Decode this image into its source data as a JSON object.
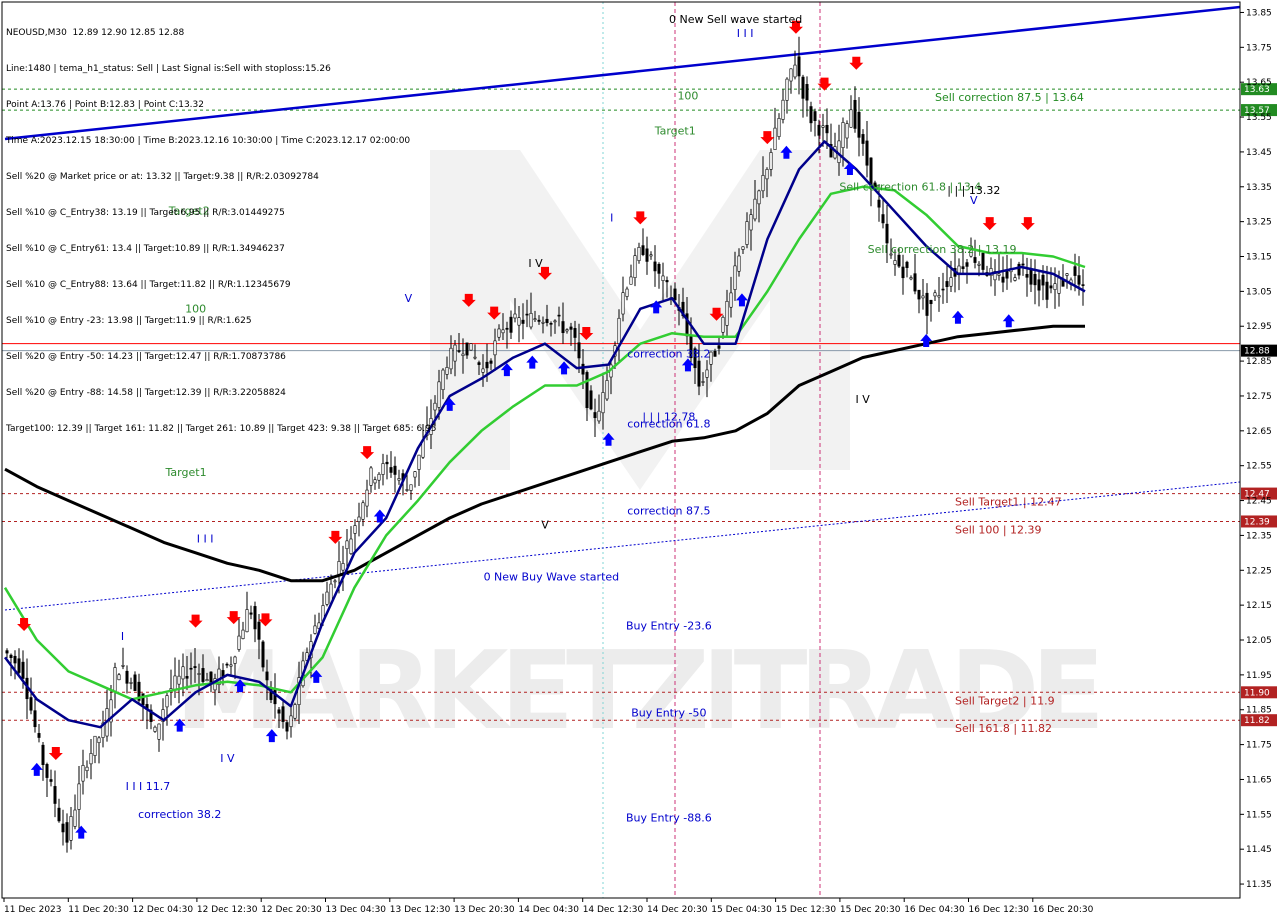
{
  "symbol_line": "NEOUSD,M30  12.89 12.90 12.85 12.88",
  "info_lines": [
    "Line:1480 | tema_h1_status: Sell | Last Signal is:Sell with stoploss:15.26",
    "Point A:13.76 | Point B:12.83 | Point C:13.32",
    "Time A:2023.12.15 18:30:00 | Time B:2023.12.16 10:30:00 | Time C:2023.12.17 02:00:00",
    "Sell %20 @ Market price or at: 13.32 || Target:9.38 || R/R:2.03092784",
    "Sell %10 @ C_Entry38: 13.19 || Target:6.95 || R/R:3.01449275",
    "Sell %10 @ C_Entry61: 13.4 || Target:10.89 || R/R:1.34946237",
    "Sell %10 @ C_Entry88: 13.64 || Target:11.82 || R/R:1.12345679",
    "Sell %10 @ Entry -23: 13.98 || Target:11.9 || R/R:1.625",
    "Sell %20 @ Entry -50: 14.23 || Target:12.47 || R/R:1.70873786",
    "Sell %20 @ Entry -88: 14.58 || Target:12.39 || R/R:3.22058824",
    "Target100: 12.39 || Target 161: 11.82 || Target 261: 10.89 || Target 423: 9.38 || Target 685: 6.95"
  ],
  "watermark": "MARKETZITRADE",
  "colors": {
    "bg": "#ffffff",
    "bull": "#000000",
    "bear": "#000000",
    "ma_fast": "#00008b",
    "ma_mid": "#32cd32",
    "ma_slow": "#000000",
    "trend": "#0000cd",
    "sell_level": "#b22222",
    "green_level": "#228b22",
    "up_arrow": "#0000ff",
    "down_arrow": "#ff0000"
  },
  "chart_data": {
    "type": "candlestick",
    "symbol": "NEOUSD",
    "timeframe": "M30",
    "ylim": [
      11.31,
      13.88
    ],
    "y_ticks": [
      13.85,
      13.75,
      13.65,
      13.55,
      13.45,
      13.35,
      13.25,
      13.15,
      13.05,
      12.95,
      12.85,
      12.75,
      12.65,
      12.55,
      12.45,
      12.35,
      12.25,
      12.15,
      12.05,
      11.95,
      11.85,
      11.75,
      11.65,
      11.55,
      11.45,
      11.35
    ],
    "x_ticks": [
      "11 Dec 2023",
      "11 Dec 20:30",
      "12 Dec 04:30",
      "12 Dec 12:30",
      "12 Dec 20:30",
      "13 Dec 04:30",
      "13 Dec 12:30",
      "13 Dec 20:30",
      "14 Dec 04:30",
      "14 Dec 12:30",
      "14 Dec 20:30",
      "15 Dec 04:30",
      "15 Dec 12:30",
      "15 Dec 20:30",
      "16 Dec 04:30",
      "16 Dec 12:30",
      "16 Dec 20:30"
    ],
    "bars": 270,
    "path": [
      [
        0,
        12.02
      ],
      [
        6,
        11.97
      ],
      [
        12,
        11.72
      ],
      [
        16,
        11.6
      ],
      [
        20,
        11.47
      ],
      [
        26,
        11.7
      ],
      [
        32,
        11.8
      ],
      [
        36,
        11.98
      ],
      [
        42,
        11.92
      ],
      [
        48,
        11.78
      ],
      [
        52,
        11.9
      ],
      [
        60,
        11.98
      ],
      [
        66,
        11.92
      ],
      [
        72,
        11.99
      ],
      [
        78,
        12.15
      ],
      [
        84,
        11.9
      ],
      [
        90,
        11.78
      ],
      [
        96,
        12.02
      ],
      [
        104,
        12.22
      ],
      [
        110,
        12.35
      ],
      [
        116,
        12.52
      ],
      [
        122,
        12.55
      ],
      [
        128,
        12.48
      ],
      [
        134,
        12.65
      ],
      [
        140,
        12.85
      ],
      [
        146,
        12.9
      ],
      [
        152,
        12.82
      ],
      [
        158,
        12.95
      ],
      [
        165,
        12.97
      ],
      [
        172,
        12.98
      ],
      [
        180,
        12.93
      ],
      [
        186,
        12.68
      ],
      [
        190,
        12.75
      ],
      [
        196,
        13.05
      ],
      [
        202,
        13.18
      ],
      [
        208,
        13.08
      ],
      [
        214,
        13.0
      ],
      [
        220,
        12.78
      ],
      [
        226,
        12.9
      ],
      [
        232,
        13.15
      ],
      [
        238,
        13.3
      ],
      [
        244,
        13.5
      ],
      [
        250,
        13.72
      ],
      [
        255,
        13.55
      ],
      [
        260,
        13.5
      ],
      [
        262,
        13.42
      ],
      [
        268,
        13.58
      ],
      [
        275,
        13.35
      ],
      [
        280,
        13.15
      ],
      [
        286,
        13.1
      ],
      [
        292,
        13.0
      ],
      [
        298,
        13.08
      ],
      [
        306,
        13.16
      ],
      [
        314,
        13.08
      ],
      [
        322,
        13.12
      ],
      [
        330,
        13.05
      ],
      [
        338,
        13.1
      ],
      [
        344,
        13.0
      ],
      [
        350,
        12.88
      ]
    ],
    "ma_fast_path": [
      [
        0,
        12.0
      ],
      [
        10,
        11.88
      ],
      [
        20,
        11.82
      ],
      [
        30,
        11.8
      ],
      [
        40,
        11.88
      ],
      [
        50,
        11.82
      ],
      [
        60,
        11.9
      ],
      [
        70,
        11.95
      ],
      [
        80,
        11.93
      ],
      [
        90,
        11.86
      ],
      [
        100,
        12.1
      ],
      [
        110,
        12.3
      ],
      [
        120,
        12.4
      ],
      [
        130,
        12.6
      ],
      [
        140,
        12.75
      ],
      [
        150,
        12.8
      ],
      [
        160,
        12.86
      ],
      [
        170,
        12.9
      ],
      [
        180,
        12.83
      ],
      [
        190,
        12.84
      ],
      [
        200,
        13.0
      ],
      [
        210,
        13.03
      ],
      [
        220,
        12.9
      ],
      [
        230,
        12.9
      ],
      [
        240,
        13.2
      ],
      [
        250,
        13.4
      ],
      [
        258,
        13.48
      ],
      [
        268,
        13.4
      ],
      [
        278,
        13.3
      ],
      [
        290,
        13.18
      ],
      [
        300,
        13.1
      ],
      [
        310,
        13.1
      ],
      [
        320,
        13.12
      ],
      [
        330,
        13.1
      ],
      [
        340,
        13.05
      ]
    ],
    "ma_mid_path": [
      [
        0,
        12.2
      ],
      [
        10,
        12.05
      ],
      [
        20,
        11.96
      ],
      [
        30,
        11.92
      ],
      [
        40,
        11.88
      ],
      [
        50,
        11.9
      ],
      [
        60,
        11.92
      ],
      [
        70,
        11.93
      ],
      [
        80,
        11.92
      ],
      [
        90,
        11.9
      ],
      [
        100,
        12.0
      ],
      [
        110,
        12.2
      ],
      [
        120,
        12.35
      ],
      [
        130,
        12.45
      ],
      [
        140,
        12.56
      ],
      [
        150,
        12.65
      ],
      [
        160,
        12.72
      ],
      [
        170,
        12.78
      ],
      [
        180,
        12.78
      ],
      [
        190,
        12.82
      ],
      [
        200,
        12.9
      ],
      [
        210,
        12.93
      ],
      [
        220,
        12.92
      ],
      [
        230,
        12.92
      ],
      [
        240,
        13.05
      ],
      [
        250,
        13.2
      ],
      [
        260,
        13.33
      ],
      [
        270,
        13.35
      ],
      [
        280,
        13.34
      ],
      [
        290,
        13.27
      ],
      [
        300,
        13.18
      ],
      [
        310,
        13.16
      ],
      [
        320,
        13.16
      ],
      [
        330,
        13.15
      ],
      [
        340,
        13.12
      ]
    ],
    "ma_slow_path": [
      [
        0,
        12.54
      ],
      [
        10,
        12.49
      ],
      [
        20,
        12.45
      ],
      [
        30,
        12.41
      ],
      [
        40,
        12.37
      ],
      [
        50,
        12.33
      ],
      [
        60,
        12.3
      ],
      [
        70,
        12.27
      ],
      [
        80,
        12.25
      ],
      [
        90,
        12.22
      ],
      [
        100,
        12.22
      ],
      [
        110,
        12.25
      ],
      [
        120,
        12.3
      ],
      [
        130,
        12.35
      ],
      [
        140,
        12.4
      ],
      [
        150,
        12.44
      ],
      [
        160,
        12.47
      ],
      [
        170,
        12.5
      ],
      [
        180,
        12.53
      ],
      [
        190,
        12.56
      ],
      [
        200,
        12.59
      ],
      [
        210,
        12.62
      ],
      [
        220,
        12.63
      ],
      [
        230,
        12.65
      ],
      [
        240,
        12.7
      ],
      [
        250,
        12.78
      ],
      [
        260,
        12.82
      ],
      [
        270,
        12.86
      ],
      [
        280,
        12.88
      ],
      [
        290,
        12.9
      ],
      [
        300,
        12.92
      ],
      [
        310,
        12.93
      ],
      [
        320,
        12.94
      ],
      [
        330,
        12.95
      ],
      [
        340,
        12.95
      ]
    ],
    "current_price": 12.88,
    "price_line": 12.9,
    "levels": [
      {
        "price": 13.63,
        "label": "Sell correction 87.5 | 13.64",
        "tag": "13.63",
        "color": "green"
      },
      {
        "price": 13.57,
        "label": "",
        "tag": "13.57",
        "color": "green"
      },
      {
        "price": 12.47,
        "label": "Sell Target1 | 12.47",
        "tag": "12.47",
        "color": "red"
      },
      {
        "price": 12.39,
        "label": "Sell 100 | 12.39",
        "tag": "12.39",
        "color": "red"
      },
      {
        "price": 11.9,
        "label": "Sell Target2 | 11.9",
        "tag": "11.90",
        "color": "red"
      },
      {
        "price": 11.82,
        "label": "Sell 161.8 | 11.82",
        "tag": "11.82",
        "color": "red"
      }
    ],
    "annotations": [
      {
        "text": "0 New Sell wave started",
        "t": 230,
        "p": 13.82,
        "color": "black"
      },
      {
        "text": "0 New Buy Wave started",
        "t": 172,
        "p": 12.22,
        "color": "blue"
      },
      {
        "text": "Sell correction 61.8 | 13.4",
        "t": 285,
        "p": 13.34,
        "color": "green"
      },
      {
        "text": "Sell correction 38.2 | 13.19",
        "t": 295,
        "p": 13.16,
        "color": "green"
      },
      {
        "text": "| | | 13.32",
        "t": 305,
        "p": 13.33,
        "color": "black"
      },
      {
        "text": "I V",
        "t": 270,
        "p": 12.73,
        "color": "black"
      },
      {
        "text": "I I I",
        "t": 63,
        "p": 12.33,
        "color": "blue"
      },
      {
        "text": "I",
        "t": 37,
        "p": 12.05,
        "color": "blue"
      },
      {
        "text": "I V",
        "t": 70,
        "p": 11.7,
        "color": "blue"
      },
      {
        "text": "I I I 11.7",
        "t": 45,
        "p": 11.62,
        "color": "blue"
      },
      {
        "text": "correction 38.2",
        "t": 55,
        "p": 11.54,
        "color": "blue"
      },
      {
        "text": "V",
        "t": 127,
        "p": 13.02,
        "color": "blue"
      },
      {
        "text": "I V",
        "t": 167,
        "p": 13.12,
        "color": "black"
      },
      {
        "text": "V",
        "t": 170,
        "p": 12.37,
        "color": "black"
      },
      {
        "text": "correction 38.2",
        "t": 209,
        "p": 12.86,
        "color": "blue"
      },
      {
        "text": "| | | 12.78",
        "t": 209,
        "p": 12.68,
        "color": "blue"
      },
      {
        "text": "correction 61.8",
        "t": 209,
        "p": 12.66,
        "color": "blue"
      },
      {
        "text": "correction 87.5",
        "t": 209,
        "p": 12.41,
        "color": "blue"
      },
      {
        "text": "Buy Entry -23.6",
        "t": 209,
        "p": 12.08,
        "color": "blue"
      },
      {
        "text": "Buy Entry -50",
        "t": 209,
        "p": 11.83,
        "color": "blue"
      },
      {
        "text": "Buy Entry -88.6",
        "t": 209,
        "p": 11.53,
        "color": "blue"
      },
      {
        "text": "I I I",
        "t": 233,
        "p": 13.78,
        "color": "blue"
      },
      {
        "text": "I",
        "t": 191,
        "p": 13.25,
        "color": "blue"
      },
      {
        "text": "100",
        "t": 215,
        "p": 13.6,
        "color": "green"
      },
      {
        "text": "Target1",
        "t": 211,
        "p": 13.5,
        "color": "green"
      },
      {
        "text": "100",
        "t": 60,
        "p": 12.99,
        "color": "green"
      },
      {
        "text": "Target2",
        "t": 58,
        "p": 13.27,
        "color": "green"
      },
      {
        "text": "Target1",
        "t": 57,
        "p": 12.52,
        "color": "green"
      },
      {
        "text": "V",
        "t": 305,
        "p": 13.3,
        "color": "blue"
      }
    ]
  }
}
